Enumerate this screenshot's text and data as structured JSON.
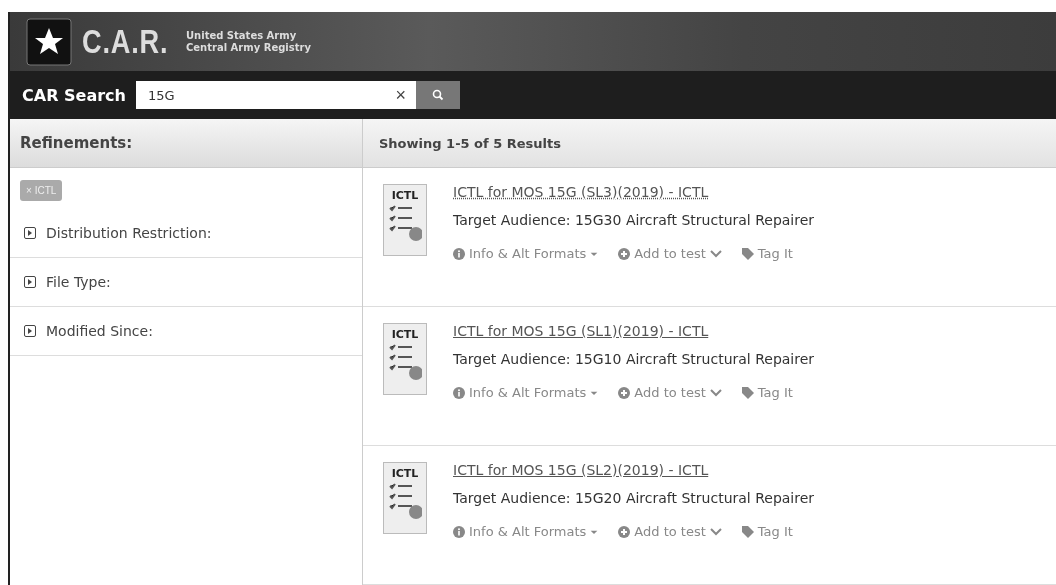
{
  "header": {
    "logo_text": "C.A.R.",
    "subtitle_lines": [
      "United States Army",
      "Central Army Registry"
    ]
  },
  "search": {
    "label": "CAR Search",
    "value": "15G",
    "clear": "×"
  },
  "refinements": {
    "title": "Refinements:",
    "active_filters": [
      {
        "label": "ICTL",
        "remove": "×"
      }
    ],
    "groups": [
      {
        "label": "Distribution Restriction:",
        "expanded": false
      },
      {
        "label": "File Type:",
        "expanded": false
      },
      {
        "label": "Modified Since:",
        "expanded": false
      }
    ]
  },
  "results": {
    "summary": "Showing 1-5 of 5 Results",
    "items": [
      {
        "icon_label": "ICTL",
        "title": "ICTL for MOS 15G (SL3)(2019) - ICTL",
        "audience": "Target Audience: 15G30 Aircraft Structural Repairer",
        "actions": [
          "Info & Alt Formats",
          "Add to test",
          "Tag It"
        ]
      },
      {
        "icon_label": "ICTL",
        "title": "ICTL for MOS 15G (SL1)(2019) - ICTL",
        "audience": "Target Audience: 15G10 Aircraft Structural Repairer",
        "actions": [
          "Info & Alt Formats",
          "Add to test",
          "Tag It"
        ]
      },
      {
        "icon_label": "ICTL",
        "title": "ICTL for MOS 15G (SL2)(2019) - ICTL",
        "audience": "Target Audience: 15G20 Aircraft Structural Repairer",
        "actions": [
          "Info & Alt Formats",
          "Add to test",
          "Tag It"
        ]
      }
    ]
  }
}
